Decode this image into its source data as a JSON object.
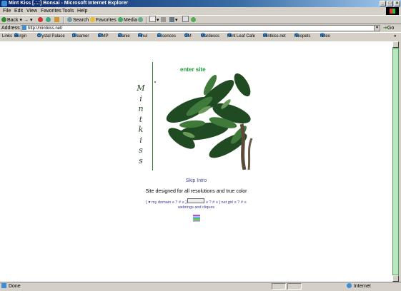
{
  "window": {
    "title": "Mint Kiss [.:.:] Bonsai - Microsoft Internet Explorer"
  },
  "menu": [
    "File",
    "Edit",
    "View",
    "Favorites",
    "Tools",
    "Help"
  ],
  "toolbar": {
    "back": "Back",
    "search": "Search",
    "favorites": "Favorites",
    "media": "Media"
  },
  "address": {
    "label": "Address",
    "url": "http://mintkiss.net/",
    "go": "Go"
  },
  "links": {
    "label": "Links",
    "items": [
      "Burgin",
      "Crystal Palace",
      "Dreamer",
      "EIMP",
      "Elanie",
      "Fihul",
      "Essences",
      "GM",
      "Mardesss",
      "Mint Leaf Cafe",
      "Mintkiss.net",
      "Neopets",
      "Niteo"
    ]
  },
  "page": {
    "vertical_title": [
      "M",
      "i",
      "n",
      "t",
      "k",
      "i",
      "s",
      "s"
    ],
    "enter_site": "enter site",
    "skip_intro": "Skip Intro",
    "designed_text": "Site designed for all resolutions and true color",
    "webring_line1_left": "[ ♥ my domain ≡ ? # ≡ ]",
    "webring_line1_right": "≡ ? # ≡ ] net girl ≡ ? # ≡",
    "webring_line2": "webrings and cliques"
  },
  "status": {
    "left": "Done",
    "right": "Internet"
  },
  "colors": {
    "accent_green": "#1a9a3a",
    "link_blue": "#4a4aa0",
    "titlebar": "#0a246a"
  }
}
